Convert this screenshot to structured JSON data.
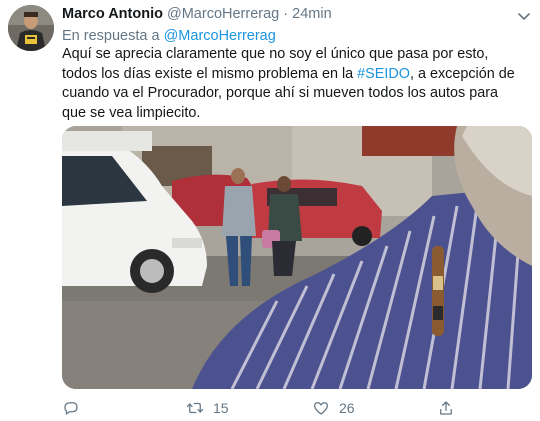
{
  "author": {
    "display_name": "Marco Antonio",
    "handle": "@MarcoHerrerag",
    "separator": "·",
    "time": "24min"
  },
  "reply_to": {
    "prefix": "En respuesta a",
    "handle": "@MarcoHerrerag"
  },
  "body": {
    "line1": "Aquí se aprecia claramente que no soy el único que pasa por esto,",
    "line2_pre": "todos los días existe el mismo problema en la ",
    "hashtag": "#SEIDO",
    "line2_post": ", a excepción de",
    "line3": "cuando va el Procurador, porque ahí si mueven todos los autos para",
    "line4": "que se vea limpiecito."
  },
  "actions": {
    "reply_icon": "reply-icon",
    "retweet_icon": "retweet-icon",
    "retweet_count": "15",
    "like_icon": "heart-icon",
    "like_count": "26",
    "share_icon": "share-icon"
  },
  "colors": {
    "link": "#1b95e0",
    "secondary": "#657786",
    "text": "#14171a"
  }
}
